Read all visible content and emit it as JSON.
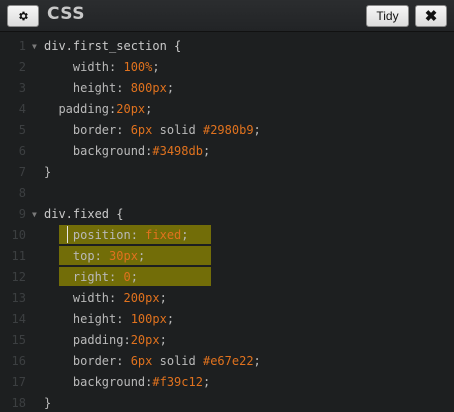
{
  "header": {
    "title": "CSS",
    "tidy_label": "Tidy",
    "close_label": "✖",
    "gear_icon": "gear-icon"
  },
  "colors": {
    "property": "#b9b9b9",
    "value": "#e0721e",
    "selector": "#c9c9c9",
    "highlight": "#7a7406",
    "line_number": "#3c3f41"
  },
  "editor": {
    "lines": [
      {
        "n": "1",
        "fold": "▼",
        "parts": [
          [
            "sel",
            "div.first_section {"
          ]
        ]
      },
      {
        "n": "2",
        "fold": "",
        "parts": [
          [
            "prop",
            "    width: "
          ],
          [
            "val",
            "100%"
          ],
          [
            "punc",
            ";"
          ]
        ]
      },
      {
        "n": "3",
        "fold": "",
        "parts": [
          [
            "prop",
            "    height: "
          ],
          [
            "val",
            "800px"
          ],
          [
            "punc",
            ";"
          ]
        ]
      },
      {
        "n": "4",
        "fold": "",
        "parts": [
          [
            "prop",
            "  padding:"
          ],
          [
            "val",
            "20px"
          ],
          [
            "punc",
            ";"
          ]
        ]
      },
      {
        "n": "5",
        "fold": "",
        "parts": [
          [
            "prop",
            "    border: "
          ],
          [
            "val",
            "6px"
          ],
          [
            "prop",
            " solid "
          ],
          [
            "val",
            "#2980b9"
          ],
          [
            "punc",
            ";"
          ]
        ]
      },
      {
        "n": "6",
        "fold": "",
        "parts": [
          [
            "prop",
            "    background:"
          ],
          [
            "val",
            "#3498db"
          ],
          [
            "punc",
            ";"
          ]
        ]
      },
      {
        "n": "7",
        "fold": "",
        "parts": [
          [
            "punc",
            "}"
          ]
        ]
      },
      {
        "n": "8",
        "fold": "",
        "parts": []
      },
      {
        "n": "9",
        "fold": "▼",
        "parts": [
          [
            "sel",
            "div.fixed {"
          ]
        ]
      },
      {
        "n": "10",
        "fold": "",
        "parts": [
          [
            "prop",
            "    position: "
          ],
          [
            "val",
            "fixed"
          ],
          [
            "punc",
            ";"
          ]
        ]
      },
      {
        "n": "11",
        "fold": "",
        "parts": [
          [
            "prop",
            "    top: "
          ],
          [
            "val",
            "30px"
          ],
          [
            "punc",
            ";"
          ]
        ]
      },
      {
        "n": "12",
        "fold": "",
        "parts": [
          [
            "prop",
            "    right: "
          ],
          [
            "val",
            "0"
          ],
          [
            "punc",
            ";"
          ]
        ]
      },
      {
        "n": "13",
        "fold": "",
        "parts": [
          [
            "prop",
            "    width: "
          ],
          [
            "val",
            "200px"
          ],
          [
            "punc",
            ";"
          ]
        ]
      },
      {
        "n": "14",
        "fold": "",
        "parts": [
          [
            "prop",
            "    height: "
          ],
          [
            "val",
            "100px"
          ],
          [
            "punc",
            ";"
          ]
        ]
      },
      {
        "n": "15",
        "fold": "",
        "parts": [
          [
            "prop",
            "    padding:"
          ],
          [
            "val",
            "20px"
          ],
          [
            "punc",
            ";"
          ]
        ]
      },
      {
        "n": "16",
        "fold": "",
        "parts": [
          [
            "prop",
            "    border: "
          ],
          [
            "val",
            "6px"
          ],
          [
            "prop",
            " solid "
          ],
          [
            "val",
            "#e67e22"
          ],
          [
            "punc",
            ";"
          ]
        ]
      },
      {
        "n": "17",
        "fold": "",
        "parts": [
          [
            "prop",
            "    background:"
          ],
          [
            "val",
            "#f39c12"
          ],
          [
            "punc",
            ";"
          ]
        ]
      },
      {
        "n": "18",
        "fold": "",
        "parts": [
          [
            "punc",
            "}"
          ]
        ]
      }
    ],
    "highlighted_lines": [
      "10",
      "11",
      "12"
    ]
  }
}
